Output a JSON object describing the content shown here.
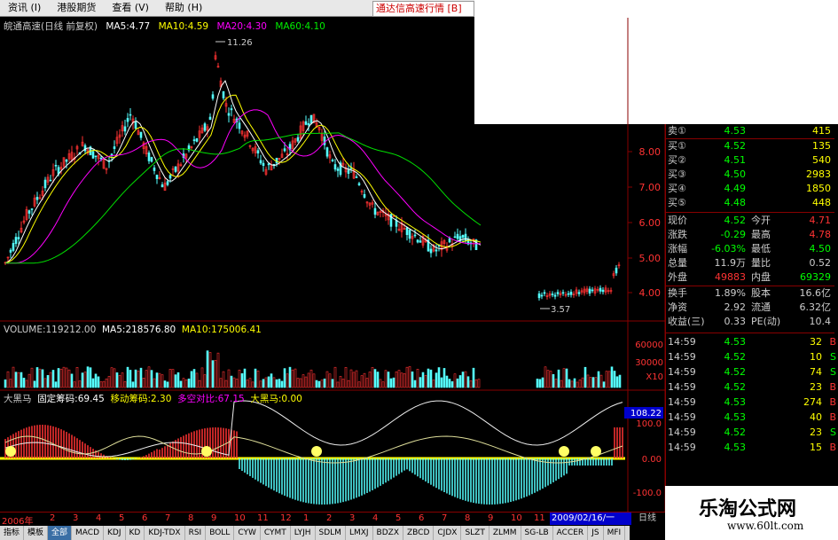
{
  "menu": {
    "items": [
      "资讯 (I)",
      "港股期货",
      "查看 (V)",
      "帮助 (H)"
    ],
    "ad": "通达信高速行情 [B]"
  },
  "info": {
    "name": "皖通高速(日线 前复权)",
    "ma5": "MA5:4.77",
    "ma10": "MA10:4.59",
    "ma20": "MA20:4.30",
    "ma60": "MA60:4.10"
  },
  "chart_labels": {
    "high": "11.26",
    "low": "3.57"
  },
  "price_axis": [
    "8.00",
    "7.00",
    "6.00",
    "5.00",
    "4.00"
  ],
  "volume": {
    "header": "VOLUME:119212.00",
    "ma5": "MA5:218576.80",
    "ma10": "MA10:175006.41",
    "ticks": [
      "60000",
      "30000",
      "X10"
    ]
  },
  "osc": {
    "title": "大黑马",
    "fixed": "固定筹码:69.45",
    "move": "移动筹码:2.30",
    "ratio": "多空对比:67.15",
    "horse": "大黑马:0.00",
    "ticks": [
      "108.22",
      "100.0",
      "0.00",
      "-100.0"
    ]
  },
  "quote": {
    "sell": [
      {
        "label": "卖①",
        "price": "4.53",
        "vol": "415"
      }
    ],
    "buy": [
      {
        "label": "买①",
        "price": "4.52",
        "vol": "135"
      },
      {
        "label": "买②",
        "price": "4.51",
        "vol": "540"
      },
      {
        "label": "买③",
        "price": "4.50",
        "vol": "2983"
      },
      {
        "label": "买④",
        "price": "4.49",
        "vol": "1850"
      },
      {
        "label": "买⑤",
        "price": "4.48",
        "vol": "448"
      }
    ],
    "stats": [
      {
        "l": "现价",
        "v": "4.52",
        "n": "今开",
        "r": "4.71"
      },
      {
        "l": "涨跌",
        "v": "-0.29",
        "n": "最高",
        "r": "4.78"
      },
      {
        "l": "涨幅",
        "v": "-6.03%",
        "n": "最低",
        "r": "4.50"
      },
      {
        "l": "总量",
        "v": "11.9万",
        "n": "量比",
        "r": "0.52"
      },
      {
        "l": "外盘",
        "v": "49883",
        "n": "内盘",
        "r": "69329"
      },
      {
        "l": "换手",
        "v": "1.89%",
        "n": "股本",
        "r": "16.6亿"
      },
      {
        "l": "净资",
        "v": "2.92",
        "n": "流通",
        "r": "6.32亿"
      },
      {
        "l": "收益(三)",
        "v": "0.33",
        "n": "PE(动)",
        "r": "10.4"
      }
    ],
    "ticks": [
      {
        "t": "14:59",
        "p": "4.53",
        "v": "32",
        "d": "B"
      },
      {
        "t": "14:59",
        "p": "4.52",
        "v": "10",
        "d": "S"
      },
      {
        "t": "14:59",
        "p": "4.52",
        "v": "74",
        "d": "S"
      },
      {
        "t": "14:59",
        "p": "4.52",
        "v": "23",
        "d": "B"
      },
      {
        "t": "14:59",
        "p": "4.53",
        "v": "274",
        "d": "B"
      },
      {
        "t": "14:59",
        "p": "4.53",
        "v": "40",
        "d": "B"
      },
      {
        "t": "14:59",
        "p": "4.52",
        "v": "23",
        "d": "S"
      },
      {
        "t": "14:59",
        "p": "4.53",
        "v": "15",
        "d": "B"
      }
    ]
  },
  "timeline": {
    "year": "2006年",
    "months": [
      "2",
      "3",
      "4",
      "5",
      "6",
      "7",
      "8",
      "9",
      "10",
      "11",
      "12",
      "1",
      "2",
      "3",
      "4",
      "5",
      "6",
      "7",
      "8",
      "9",
      "10",
      "11"
    ],
    "date": "2009/02/16/一",
    "period": "日线"
  },
  "tabs": [
    "指标",
    "模板",
    "全部",
    "MACD",
    "KDJ",
    "KD",
    "KDJ-TDX",
    "RSI",
    "BOLL",
    "CYW",
    "CYMT",
    "LYJH",
    "SDLM",
    "LMXJ",
    "BDZX",
    "ZBCD",
    "CJDX",
    "SLZT",
    "ZLMM",
    "SG-LB",
    "ACCER",
    "JS",
    "MFI"
  ],
  "watermark": {
    "line1": "乐淘公式网",
    "line2": "www.60lt.com"
  },
  "colors": {
    "up": "#ff3232",
    "down": "#54ffff",
    "ma5": "#ffffff",
    "ma10": "#ffff00",
    "ma20": "#ff00ff",
    "ma60": "#00e000"
  }
}
